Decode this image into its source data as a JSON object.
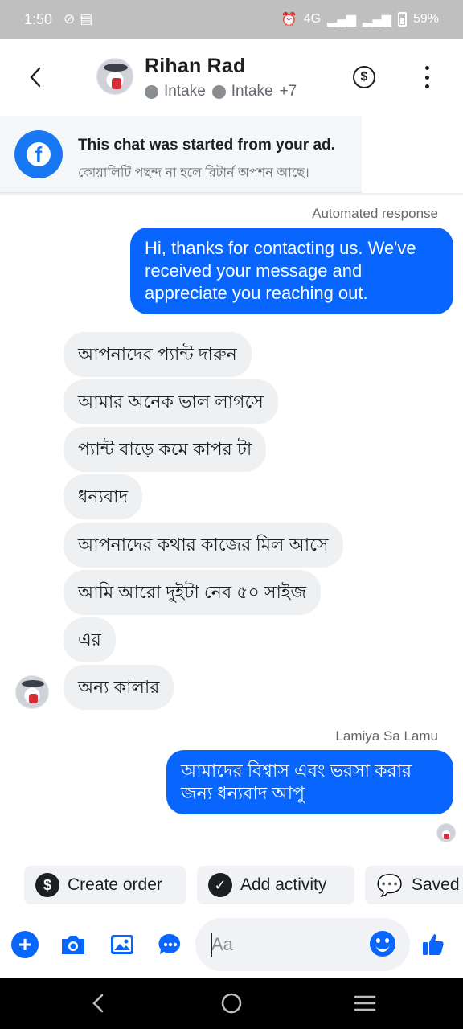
{
  "status_bar": {
    "time": "1:50",
    "network": "4G",
    "battery": "59%"
  },
  "header": {
    "contact_name": "Rihan Rad",
    "label1": "Intake",
    "label2": "Intake",
    "more_labels": "+7",
    "icons": [
      "chevron-left-icon",
      "dollar-icon",
      "more-vertical-icon"
    ]
  },
  "ad_banner": {
    "title": "This chat was started from your ad.",
    "subtitle": "কোয়ালিটি পছন্দ না হলে রিটার্ন অপশন আছে।"
  },
  "chat": {
    "automated_label": "Automated response",
    "automated_message": "Hi, thanks for contacting us. We've received your message and appreciate you reaching out.",
    "incoming": [
      "আপনাদের প্যান্ট দারুন",
      "আমার অনেক ভাল লাগসে",
      "প্যান্ট বাড়ে কমে কাপর টা",
      "ধন্যবাদ",
      "আপনাদের কথার কাজের মিল আসে",
      "আমি আরো দুইটা নেব ৫০ সাইজ",
      "এর",
      "অন্য কালার"
    ],
    "reply_sender": "Lamiya Sa Lamu",
    "reply_message": "আমাদের বিশ্বাস এবং ভরসা করার জন্য ধন্যবাদ আপু"
  },
  "quick_actions": {
    "create_order": "Create order",
    "add_activity": "Add activity",
    "saved": "Saved"
  },
  "composer": {
    "placeholder": "Aa"
  },
  "colors": {
    "accent": "#0866ff",
    "incoming_bubble": "#eff0f2",
    "status_bar": "#bfbfbf"
  }
}
